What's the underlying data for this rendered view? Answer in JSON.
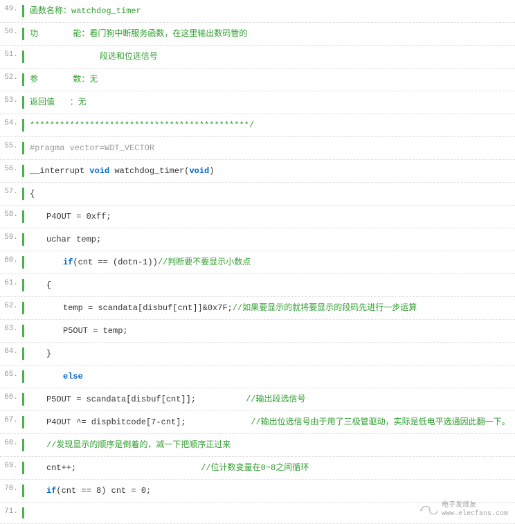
{
  "lines": [
    {
      "n": "49.",
      "text": "函数名称：watchdog_timer",
      "cls": "comment"
    },
    {
      "n": "50.",
      "text": "功       能：看门狗中断服务函数，在这里输出数码管的",
      "cls": "comment"
    },
    {
      "n": "51.",
      "text": "              段选和位选信号",
      "cls": "comment"
    },
    {
      "n": "52.",
      "text": "参       数：无",
      "cls": "comment"
    },
    {
      "n": "53.",
      "text": "返回值   ：无",
      "cls": "comment"
    },
    {
      "n": "54.",
      "text": "********************************************/",
      "cls": "comment"
    },
    {
      "n": "55.",
      "text": "#pragma vector=WDT_VECTOR",
      "cls": "preprocessor"
    },
    {
      "n": "56.",
      "html": "__interrupt <span class=\"keyword\">void</span> watchdog_timer(<span class=\"keyword\">void</span>)"
    },
    {
      "n": "57.",
      "text": "{"
    },
    {
      "n": "58.",
      "text": "P4OUT = 0xff;",
      "indent": 1
    },
    {
      "n": "59.",
      "text": "uchar temp;",
      "indent": 1
    },
    {
      "n": "60.",
      "html": "<span class=\"keyword\">if</span>(cnt == (dotn-1))<span class=\"comment\">//判断要不要显示小数点</span>",
      "indent": 2
    },
    {
      "n": "61.",
      "text": "{",
      "indent": 1
    },
    {
      "n": "62.",
      "html": "temp = scandata[disbuf[cnt]]&0x7F;<span class=\"comment\">//如果要显示的就将要显示的段码先进行一步运算</span>",
      "indent": 2
    },
    {
      "n": "63.",
      "text": "P5OUT = temp;",
      "indent": 2
    },
    {
      "n": "64.",
      "text": "}",
      "indent": 1
    },
    {
      "n": "65.",
      "html": "<span class=\"keyword\">else</span>",
      "indent": 2
    },
    {
      "n": "66.",
      "html": "P5OUT = scandata[disbuf[cnt]];          <span class=\"comment\">//输出段选信号</span>",
      "indent": 1
    },
    {
      "n": "67.",
      "html": "P4OUT ^= dispbitcode[7-cnt];             <span class=\"comment\">//输出位选信号由于用了三极管驱动，实际是低电平选通因此翻一下。</span>",
      "indent": 1
    },
    {
      "n": "68.",
      "html": "<span class=\"comment\">//发现显示的顺序是倒着的，减一下把顺序正过来</span>",
      "indent": 1
    },
    {
      "n": "69.",
      "html": "cnt++;                         <span class=\"comment\">//位计数变量在0~8之间循环</span>",
      "indent": 1
    },
    {
      "n": "70.",
      "html": "<span class=\"keyword\">if</span>(cnt == 8) cnt = 0;",
      "indent": 1
    },
    {
      "n": "71.",
      "text": ""
    }
  ],
  "watermark": {
    "title": "电子发烧友",
    "url": "www.elecfans.com"
  }
}
